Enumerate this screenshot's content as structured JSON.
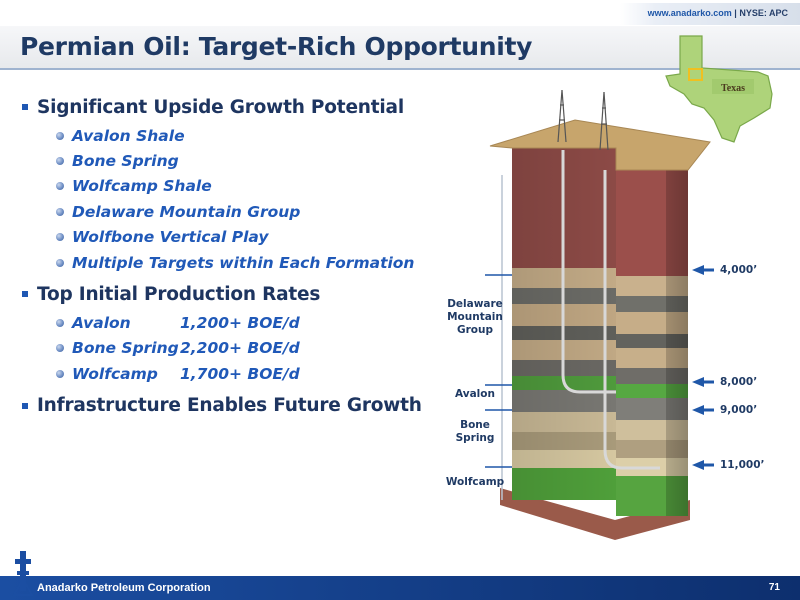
{
  "header": {
    "url": "www.anadarko.com",
    "ticker": "| NYSE: APC",
    "title": "Permian Oil: Target-Rich Opportunity"
  },
  "bullets": {
    "upside": {
      "heading": "Significant Upside Growth Potential",
      "items": [
        "Avalon Shale",
        "Bone Spring",
        "Wolfcamp Shale",
        "Delaware Mountain Group",
        "Wolfbone Vertical Play",
        "Multiple Targets within Each Formation"
      ]
    },
    "rates": {
      "heading": "Top Initial Production Rates",
      "items": [
        {
          "name": "Avalon",
          "rate": "1,200+ BOE/d"
        },
        {
          "name": "Bone Spring",
          "rate": "2,200+ BOE/d"
        },
        {
          "name": "Wolfcamp",
          "rate": "1,700+ BOE/d"
        }
      ]
    },
    "infrastructure": {
      "heading": "Infrastructure Enables Future Growth"
    }
  },
  "map": {
    "state_label": "Texas"
  },
  "diagram": {
    "formations": {
      "delaware_1": "Delaware",
      "delaware_2": "Mountain",
      "delaware_3": "Group",
      "avalon": "Avalon",
      "bone_1": "Bone",
      "bone_2": "Spring",
      "wolfcamp": "Wolfcamp"
    },
    "depths": [
      "4,000’",
      "8,000’",
      "9,000’",
      "11,000’"
    ]
  },
  "footer": {
    "company": "Anadarko Petroleum Corporation",
    "page": "71"
  },
  "colors": {
    "title": "#1f3a64",
    "bullet_text": "#2059b8",
    "footer": "#1b4ea2"
  }
}
